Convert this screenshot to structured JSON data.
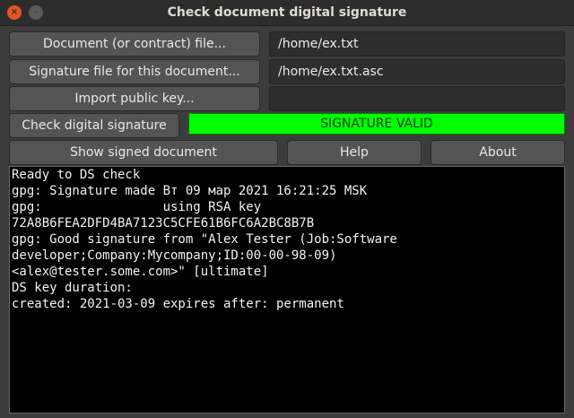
{
  "window": {
    "title": "Check document digital signature",
    "close_glyph": "×",
    "minimize_glyph": "–"
  },
  "buttons": {
    "document_file": "Document (or contract) file...",
    "signature_file": "Signature file for this document...",
    "import_key": "Import public key...",
    "check_signature": "Check digital signature",
    "show_signed": "Show signed document",
    "help": "Help",
    "about": "About"
  },
  "fields": {
    "document_path": "/home/ex.txt",
    "signature_path": "/home/ex.txt.asc",
    "public_key": ""
  },
  "status": {
    "text": "SIGNATURE VALID",
    "color": "#00ff00"
  },
  "console": {
    "lines": [
      "Ready to DS check",
      "gpg: Signature made Вт 09 мар 2021 16:21:25 MSK",
      "gpg:                using RSA key",
      "72A8B6FEA2DFD4BA7123C5CFE61B6FC6A2BC8B7B",
      "gpg: Good signature from \"Alex Tester (Job:Software",
      "developer;Company:Mycompany;ID:00-00-98-09)",
      "<alex@tester.some.com>\" [ultimate]",
      "DS key duration:",
      "created: 2021-03-09 expires after: permanent"
    ]
  },
  "colors": {
    "close_button": "#e9541f",
    "window_bg": "#3c3c3c",
    "console_bg": "#000000"
  }
}
